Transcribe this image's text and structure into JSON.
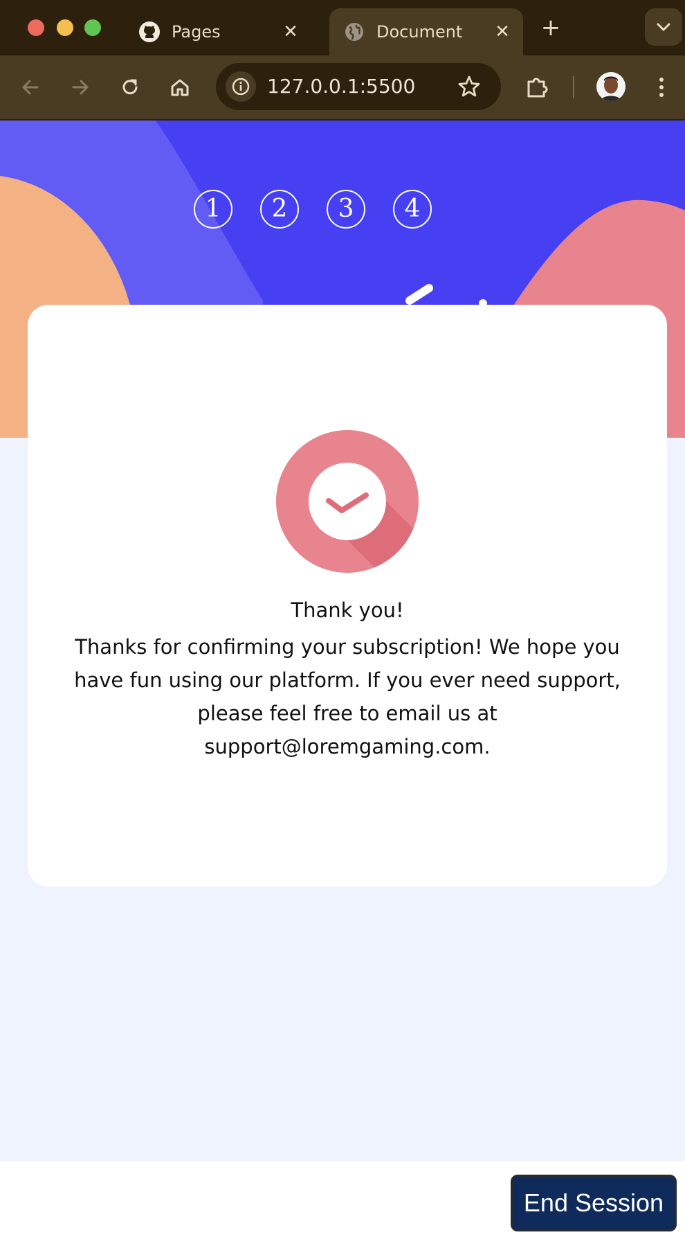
{
  "browser": {
    "tabs": [
      {
        "label": "Pages",
        "icon": "github-icon",
        "active": false
      },
      {
        "label": "Document",
        "icon": "globe-icon",
        "active": true
      }
    ],
    "url": "127.0.0.1:5500"
  },
  "page": {
    "steps": [
      "1",
      "2",
      "3",
      "4"
    ],
    "title": "Thank you!",
    "message": "Thanks for confirming your subscription! We hope you have fun using our platform. If you ever need support, please feel free to email us at support@loremgaming.com."
  },
  "footer": {
    "end_session_label": "End Session"
  },
  "colors": {
    "hero": "#4640f2",
    "accent_pink": "#e8848d",
    "accent_orange": "#f3b184",
    "page_bg": "#eff3fd",
    "button": "#0e2b5c"
  }
}
